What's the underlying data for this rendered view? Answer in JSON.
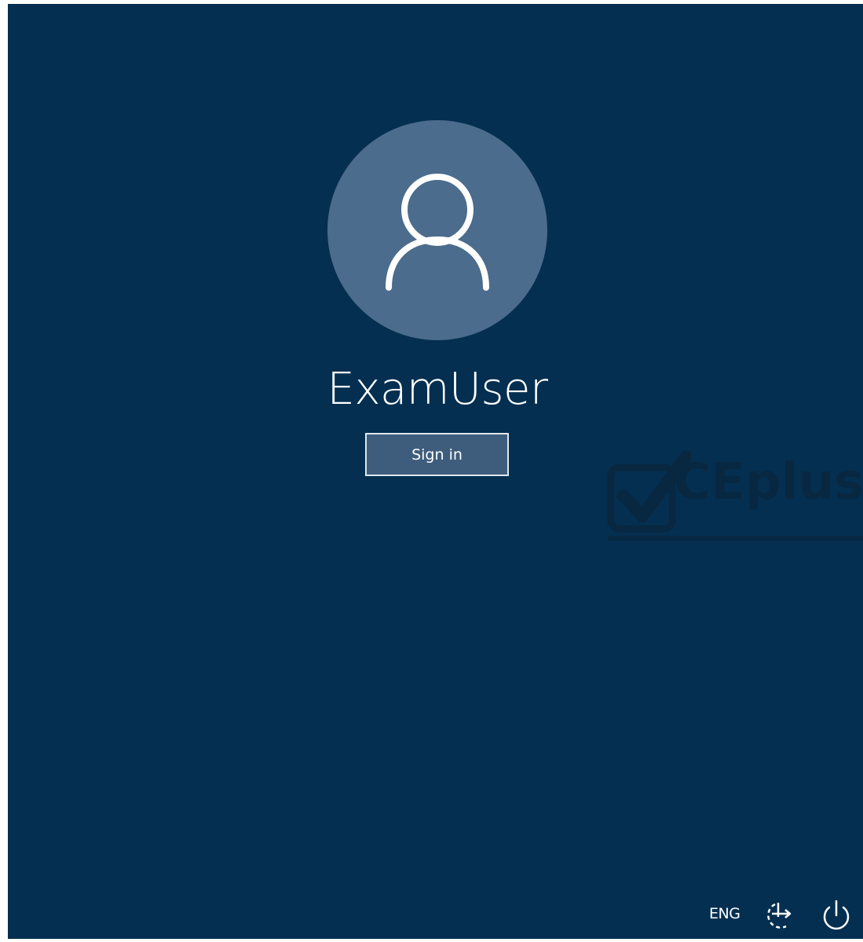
{
  "user": {
    "name": "ExamUser",
    "avatar_icon": "user-silhouette-icon"
  },
  "signin": {
    "label": "Sign in"
  },
  "tray": {
    "language": "ENG",
    "ease_of_access_icon": "ease-of-access-icon",
    "power_icon": "power-icon"
  },
  "watermark": {
    "text": "CEplus"
  },
  "colors": {
    "background": "#042f50",
    "avatar": "#4b6c8c",
    "button": "#3e5d7c",
    "text": "#ffffff"
  }
}
